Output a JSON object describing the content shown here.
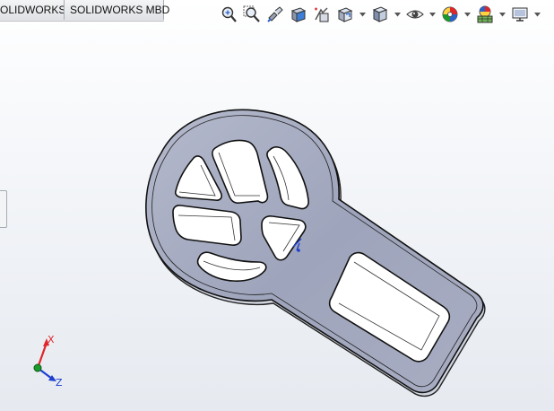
{
  "tabs": [
    {
      "label": "OLIDWORKS"
    },
    {
      "label": "SOLIDWORKS MBD"
    }
  ],
  "hud_toolbar": {
    "icons": [
      "zoom-to-fit-icon",
      "zoom-to-area-icon",
      "previous-view-icon",
      "section-view-icon",
      "dynamic-annotation-view-icon",
      "view-orientation-icon",
      "display-style-icon",
      "hide-show-items-icon",
      "edit-appearance-icon",
      "apply-scene-icon",
      "view-settings-icon"
    ]
  },
  "colors": {
    "part_face": "#9ea4bb",
    "part_edge": "#111111",
    "axis_x": "#e0262a",
    "axis_y": "#1a9a2a",
    "axis_z": "#1f3fd1"
  },
  "triad": {
    "x_label": "X",
    "z_label": "Z"
  }
}
